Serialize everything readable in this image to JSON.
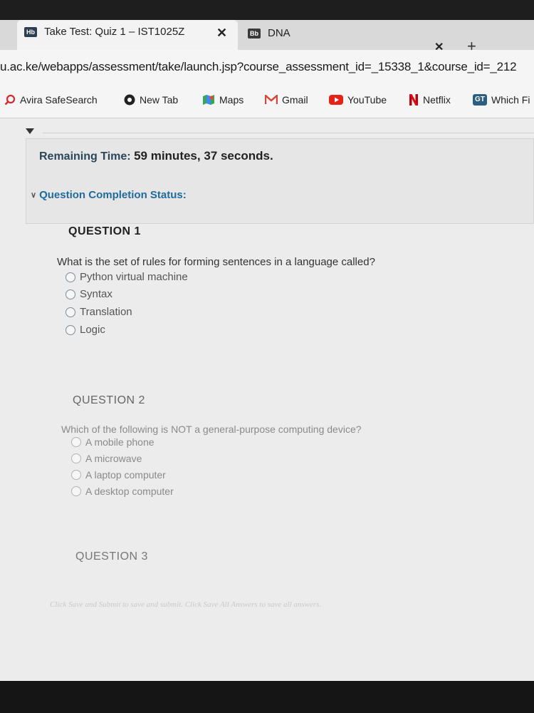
{
  "browser": {
    "tabs": [
      {
        "icon_label": "Hb",
        "title": "Take Test: Quiz 1 – IST1025Z",
        "close": "✕",
        "icon": "blackboard-icon",
        "color": "#2d3e50"
      },
      {
        "icon_label": "Bb",
        "title": "DNA",
        "close": "✕",
        "icon": "blackboard-icon",
        "color": "#3a3a3a"
      }
    ],
    "new_tab": "+",
    "url": "u.ac.ke/webapps/assessment/take/launch.jsp?course_assessment_id=_15338_1&course_id=_212",
    "bookmarks": [
      {
        "label": "Avira SafeSearch",
        "icon": "search-icon",
        "color": "#d9272e"
      },
      {
        "label": "New Tab",
        "icon": "chrome-icon",
        "color": "#222222"
      },
      {
        "label": "Maps",
        "icon": "maps-icon",
        "color": "#34a853"
      },
      {
        "label": "Gmail",
        "icon": "gmail-icon",
        "color": "#d44638"
      },
      {
        "label": "YouTube",
        "icon": "youtube-icon",
        "color": "#e62117"
      },
      {
        "label": "Netflix",
        "icon": "netflix-icon",
        "color": "#b20710"
      },
      {
        "label": "Which Fi",
        "icon": "gt-icon",
        "color": "#2e5e7e",
        "icon_label": "GT"
      }
    ]
  },
  "test": {
    "remaining_label": "Remaining Time:",
    "remaining_value": "59 minutes, 37 seconds.",
    "completion_status": "Question Completion Status:",
    "questions": [
      {
        "label": "QUESTION 1",
        "text": "What is the set of rules for forming sentences in a language called?",
        "options": [
          "Python virtual machine",
          "Syntax",
          "Translation",
          "Logic"
        ]
      },
      {
        "label": "QUESTION 2",
        "text": "Which of the following is NOT a general-purpose computing device?",
        "options": [
          "A mobile phone",
          "A microwave",
          "A laptop computer",
          "A desktop computer"
        ]
      },
      {
        "label": "QUESTION 3"
      }
    ],
    "footer_note": "Click Save and Submit to save and submit. Click Save All Answers to save all answers."
  }
}
